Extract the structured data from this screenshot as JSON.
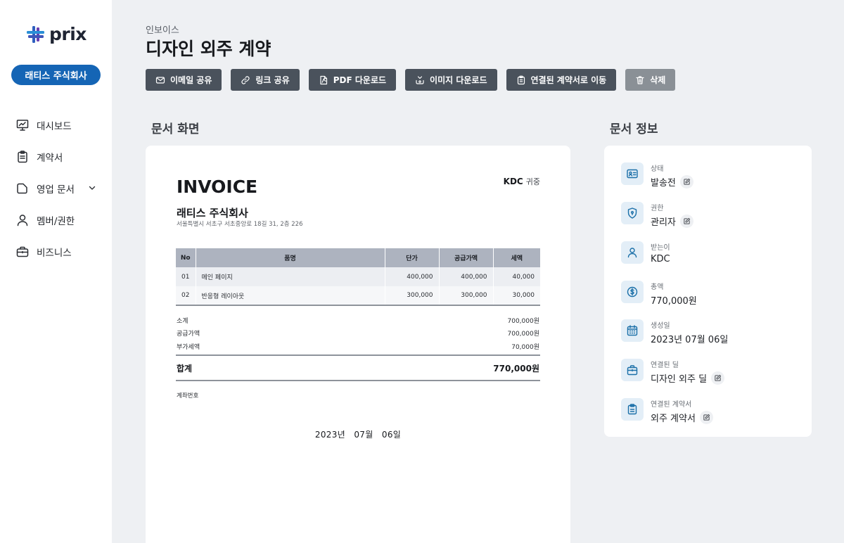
{
  "brand": {
    "name": "prix"
  },
  "sidebar": {
    "company": "래티스 주식회사",
    "items": [
      {
        "label": "대시보드",
        "icon": "presentation-chart-icon"
      },
      {
        "label": "계약서",
        "icon": "clipboard-icon"
      },
      {
        "label": "영업 문서",
        "icon": "folder-icon",
        "expandable": true
      },
      {
        "label": "멤버/권한",
        "icon": "user-icon"
      },
      {
        "label": "비즈니스",
        "icon": "briefcase-icon"
      }
    ]
  },
  "header": {
    "breadcrumb": "인보이스",
    "title": "디자인 외주 계약"
  },
  "toolbar": {
    "email_share": "이메일 공유",
    "link_share": "링크 공유",
    "pdf_download": "PDF 다운로드",
    "image_download": "이미지 다운로드",
    "go_contract": "연결된 계약서로 이동",
    "delete": "삭제"
  },
  "sections": {
    "document_view": "문서 화면",
    "document_info": "문서 정보"
  },
  "invoice": {
    "title": "INVOICE",
    "recipient": "KDC",
    "recipient_suffix": "귀중",
    "company": "래티스 주식회사",
    "address": "서울특별시 서초구 서초중앙로 18길 31, 2층 226",
    "columns": [
      "No",
      "품명",
      "단가",
      "공급가액",
      "세액"
    ],
    "rows": [
      {
        "no": "01",
        "name": "메인 페이지",
        "unit_price": "400,000",
        "supply": "400,000",
        "tax": "40,000"
      },
      {
        "no": "02",
        "name": "반응형 레이아웃",
        "unit_price": "300,000",
        "supply": "300,000",
        "tax": "30,000"
      }
    ],
    "subtotal_label": "소계",
    "subtotal": "700,000원",
    "supply_label": "공급가액",
    "supply_total": "700,000원",
    "vat_label": "부가세액",
    "vat": "70,000원",
    "total_label": "합계",
    "total": "770,000원",
    "bank_label": "계좌번호",
    "date": "2023년   07월   06일"
  },
  "info": {
    "status_label": "상태",
    "status": "발송전",
    "permission_label": "권한",
    "permission": "관리자",
    "recipient_label": "받는이",
    "recipient": "KDC",
    "amount_label": "총액",
    "amount": "770,000원",
    "created_label": "생성일",
    "created": "2023년 07월 06일",
    "deal_label": "연결된 딜",
    "deal": "디자인 외주 딜",
    "contract_label": "연결된 계약서",
    "contract": "외주 계약서"
  },
  "colors": {
    "accent": "#1565b5",
    "toolbar": "#4a525c",
    "icon_bg": "#e3eef7",
    "icon": "#1a6fa8"
  }
}
